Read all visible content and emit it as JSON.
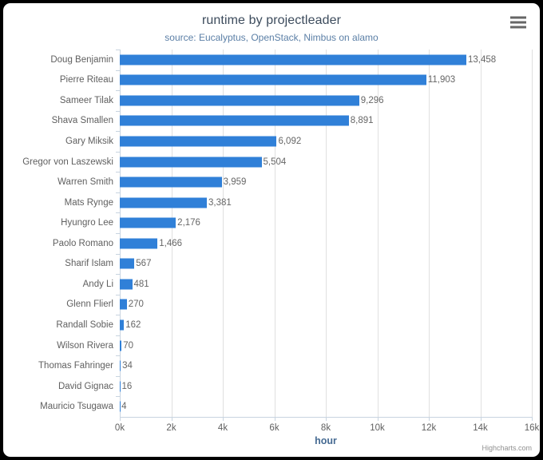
{
  "chart_data": {
    "type": "bar",
    "orientation": "horizontal",
    "title": "runtime by projectleader",
    "subtitle": "source: Eucalyptus, OpenStack, Nimbus on alamo",
    "xlabel": "hour",
    "ylabel": "",
    "xlim": [
      0,
      16000
    ],
    "xticks": [
      0,
      2000,
      4000,
      6000,
      8000,
      10000,
      12000,
      14000,
      16000
    ],
    "xtick_labels": [
      "0k",
      "2k",
      "4k",
      "6k",
      "8k",
      "10k",
      "12k",
      "14k",
      "16k"
    ],
    "grid": "vertical",
    "legend": "none",
    "series_color": "#3080d8",
    "categories": [
      "Doug Benjamin",
      "Pierre Riteau",
      "Sameer Tilak",
      "Shava Smallen",
      "Gary Miksik",
      "Gregor von Laszewski",
      "Warren Smith",
      "Mats Rynge",
      "Hyungro Lee",
      "Paolo Romano",
      "Sharif Islam",
      "Andy Li",
      "Glenn Flierl",
      "Randall Sobie",
      "Wilson Rivera",
      "Thomas Fahringer",
      "David Gignac",
      "Mauricio Tsugawa"
    ],
    "values": [
      13458,
      11903,
      9296,
      8891,
      6092,
      5504,
      3959,
      3381,
      2176,
      1466,
      567,
      481,
      270,
      162,
      70,
      34,
      16,
      4
    ],
    "value_labels": [
      "13,458",
      "11,903",
      "9,296",
      "8,891",
      "6,092",
      "5,504",
      "3,959",
      "3,381",
      "2,176",
      "1,466",
      "567",
      "481",
      "270",
      "162",
      "70",
      "34",
      "16",
      "4"
    ]
  },
  "toolbar": {
    "context_menu_label": "Chart context menu"
  },
  "credits": {
    "text": "Highcharts.com"
  },
  "colors": {
    "bar": "#3080d8",
    "title": "#3c4b5c",
    "subtitle": "#5b7fa6",
    "axis_title": "#456a92",
    "label": "#606060",
    "gridline": "#e0e0e0",
    "background": "#ffffff",
    "page_background": "#000000"
  }
}
